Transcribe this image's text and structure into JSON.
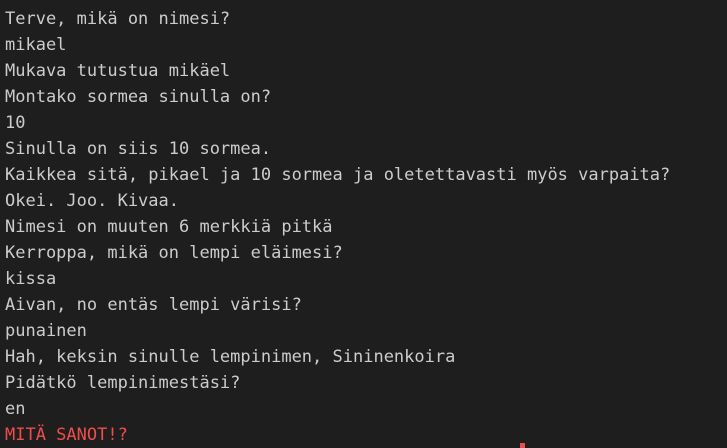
{
  "terminal": {
    "top_partial_line": "",
    "lines": [
      {
        "text": "Terve, mikä on nimesi?",
        "kind": "output"
      },
      {
        "text": "mikael",
        "kind": "input"
      },
      {
        "text": "Mukava tutustua mikäel",
        "kind": "output"
      },
      {
        "text": "Montako sormea sinulla on?",
        "kind": "output"
      },
      {
        "text": "10",
        "kind": "input"
      },
      {
        "text": "Sinulla on siis 10 sormea.",
        "kind": "output"
      },
      {
        "text": "Kaikkea sitä, pikael ja 10 sormea ja oletettavasti myös varpaita?",
        "kind": "output"
      },
      {
        "text": "Okei. Joo. Kivaa.",
        "kind": "output"
      },
      {
        "text": "Nimesi on muuten 6 merkkiä pitkä",
        "kind": "output"
      },
      {
        "text": "Kerroppa, mikä on lempi eläimesi?",
        "kind": "output"
      },
      {
        "text": "kissa",
        "kind": "input"
      },
      {
        "text": "Aivan, no entäs lempi värisi?",
        "kind": "output"
      },
      {
        "text": "punainen",
        "kind": "input"
      },
      {
        "text": "Hah, keksin sinulle lempinimen, Sininenkoira",
        "kind": "output"
      },
      {
        "text": "Pidätkö lempinimestäsi?",
        "kind": "output"
      },
      {
        "text": "en",
        "kind": "input"
      },
      {
        "text": "MITÄ SANOT!?",
        "kind": "error"
      }
    ]
  },
  "colors": {
    "background": "#1e1e1e",
    "text": "#cccccc",
    "error": "#f14c4c",
    "link": "#3794ff"
  }
}
